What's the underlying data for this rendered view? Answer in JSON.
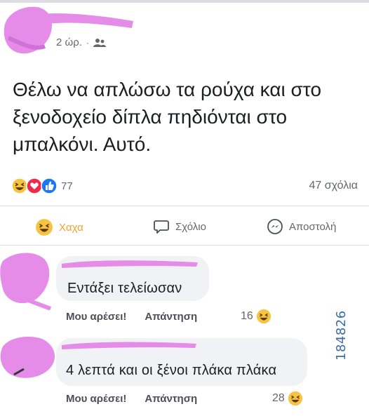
{
  "post": {
    "time": "2 ώρ.",
    "separator": "·",
    "audience_icon": "friends-icon",
    "text": "Θέλω να απλώσω τα ρούχα και στο ξενοδοχείο δίπλα πηδιόνται στο μπαλκόνι. Αυτό.",
    "reactions": {
      "icons": [
        "haha-reaction-icon",
        "love-reaction-icon",
        "like-reaction-icon"
      ],
      "count": "77"
    },
    "comments_count": "47 σχόλια"
  },
  "actions": {
    "haha": "Χαχα",
    "comment": "Σχόλιο",
    "send": "Αποστολή"
  },
  "comments": [
    {
      "text": "Εντάξει τελείωσαν",
      "like_label": "Μου αρέσει!",
      "reply_label": "Απάντηση",
      "reaction_count": "16"
    },
    {
      "text": "4 λεπτά και οι ξένοι πλάκα πλάκα",
      "like_label": "Μου αρέσει!",
      "reply_label": "Απάντηση",
      "reaction_count": "28"
    }
  ],
  "watermark": "184826",
  "colors": {
    "redaction": "#e58be8",
    "haha_yellow": "#f7c442",
    "love_red": "#f0284a",
    "like_blue": "#1877f2",
    "meta_grey": "#65676b"
  }
}
